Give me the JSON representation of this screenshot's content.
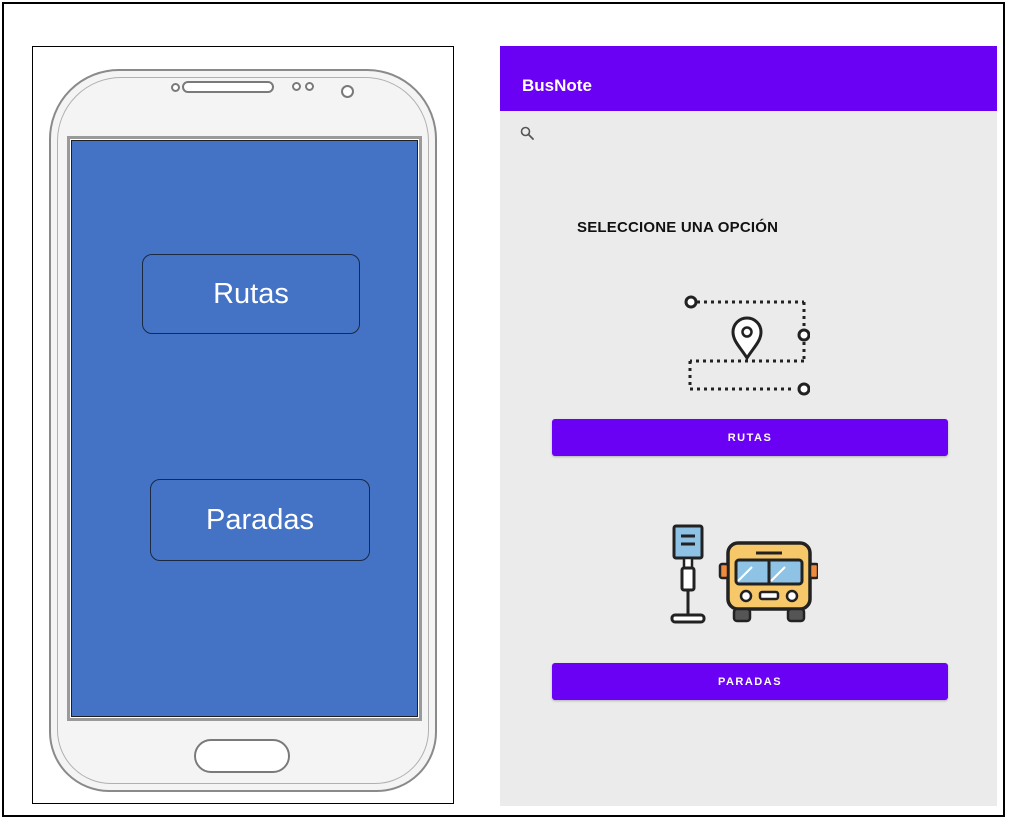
{
  "wireframe": {
    "buttons": {
      "rutas": "Rutas",
      "paradas": "Paradas"
    },
    "screen_color": "#4472c4"
  },
  "app": {
    "title": "BusNote",
    "accent_color": "#6a00f4",
    "search_icon": "search-icon",
    "heading": "SELECCIONE UNA OPCIÓN",
    "route_icon": "route-map-pin-icon",
    "rutas_button": "RUTAS",
    "bus_icon": "bus-stop-icon",
    "paradas_button": "PARADAS"
  }
}
